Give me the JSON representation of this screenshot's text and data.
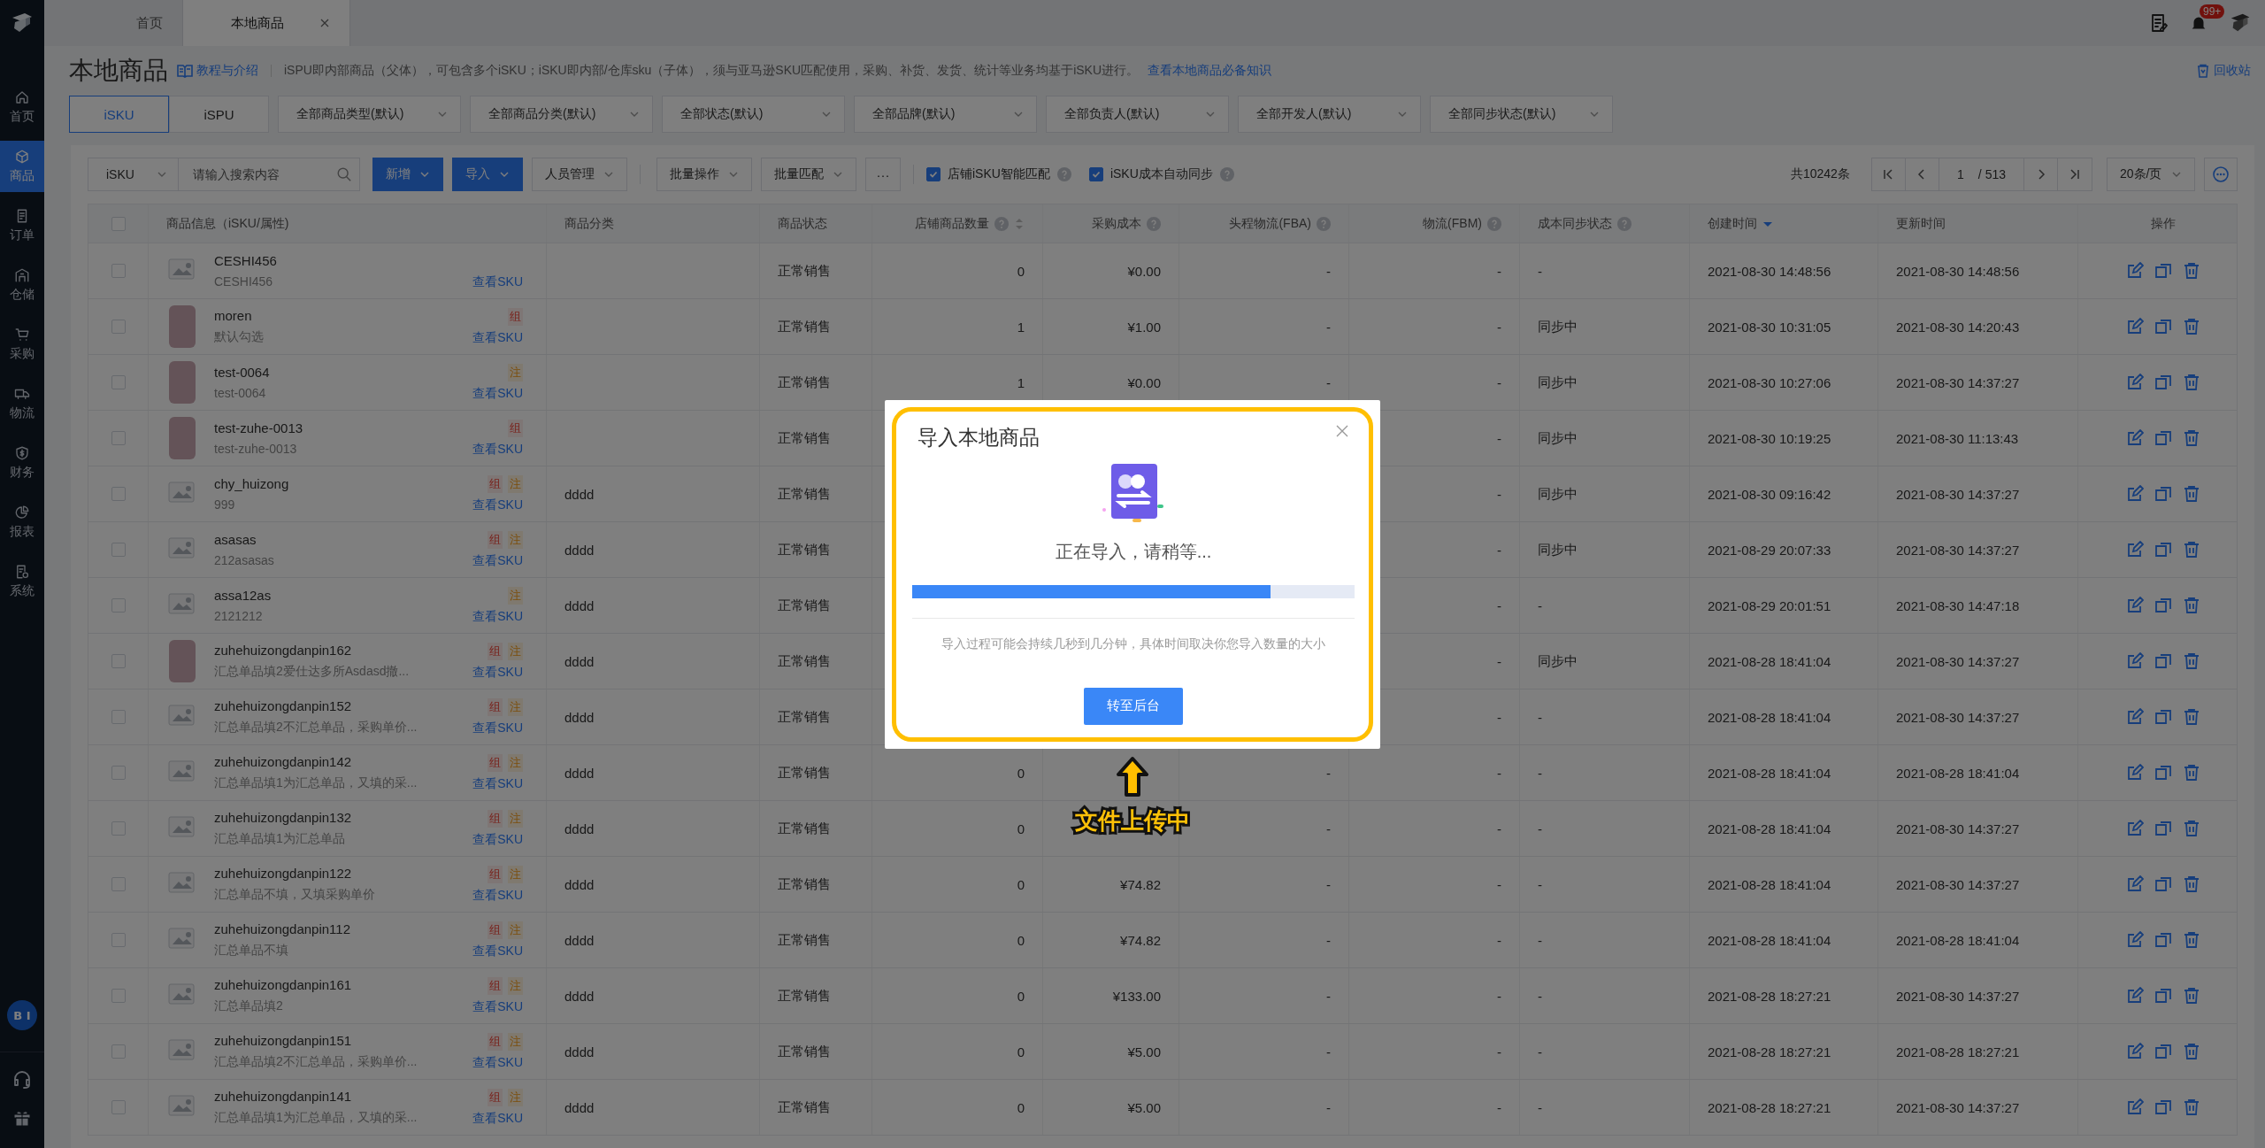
{
  "sidebar": {
    "items": [
      {
        "label": "首页",
        "selected": false
      },
      {
        "label": "商品",
        "selected": true
      },
      {
        "label": "订单",
        "selected": false
      },
      {
        "label": "仓储",
        "selected": false
      },
      {
        "label": "采购",
        "selected": false
      },
      {
        "label": "物流",
        "selected": false
      },
      {
        "label": "财务",
        "selected": false
      },
      {
        "label": "报表",
        "selected": false
      },
      {
        "label": "系统",
        "selected": false
      }
    ],
    "bi_label": "B I"
  },
  "tabs": [
    {
      "label": "首页",
      "selected": false,
      "closable": false
    },
    {
      "label": "本地商品",
      "selected": true,
      "closable": true
    }
  ],
  "notification_badge": "99+",
  "page": {
    "title": "本地商品",
    "tutorial_link": "教程与介绍",
    "description": "iSPU即内部商品（父体），可包含多个iSKU；iSKU即内部/仓库sku（子体），须与亚马逊SKU匹配使用，采购、补货、发货、统计等业务均基于iSKU进行。",
    "knowledge_link": "查看本地商品必备知识",
    "recycle_bin": "回收站"
  },
  "view_tabs": [
    {
      "label": "iSKU",
      "selected": true
    },
    {
      "label": "iSPU",
      "selected": false
    }
  ],
  "filters": [
    "全部商品类型(默认)",
    "全部商品分类(默认)",
    "全部状态(默认)",
    "全部品牌(默认)",
    "全部负责人(默认)",
    "全部开发人(默认)",
    "全部同步状态(默认)"
  ],
  "toolbar": {
    "search_type": "iSKU",
    "search_placeholder": "请输入搜索内容",
    "button_groups": [
      [
        {
          "label": "新增",
          "kind": "primary"
        },
        {
          "label": "导入",
          "kind": "primary"
        },
        {
          "label": "人员管理",
          "kind": "plain"
        }
      ],
      [
        {
          "label": "批量操作",
          "kind": "plain"
        },
        {
          "label": "批量匹配",
          "kind": "plain"
        }
      ]
    ],
    "more": "···",
    "options": [
      {
        "label": "店铺iSKU智能匹配",
        "checked": true
      },
      {
        "label": "iSKU成本自动同步",
        "checked": true
      }
    ]
  },
  "pagination": {
    "total": "共10242条",
    "page": "1",
    "pages": "/ 513",
    "page_size": "20条/页"
  },
  "table": {
    "select_all": false,
    "columns": [
      {
        "label": "商品信息（iSKU/属性)",
        "help": false,
        "sortable": false
      },
      {
        "label": "商品分类",
        "help": false,
        "sortable": false
      },
      {
        "label": "商品状态",
        "help": false,
        "sortable": false
      },
      {
        "label": "店铺商品数量",
        "help": true,
        "sortable": true,
        "sorted": false
      },
      {
        "label": "采购成本",
        "help": true,
        "sortable": false
      },
      {
        "label": "头程物流(FBA)",
        "help": true,
        "sortable": false
      },
      {
        "label": "物流(FBM)",
        "help": true,
        "sortable": false
      },
      {
        "label": "成本同步状态",
        "help": true,
        "sortable": false
      },
      {
        "label": "创建时间",
        "help": false,
        "sortable": true,
        "sorted": true
      },
      {
        "label": "更新时间",
        "help": false,
        "sortable": false
      },
      {
        "label": "操作",
        "help": false,
        "sortable": false
      }
    ],
    "rows": [
      {
        "checked": false,
        "thumbnail": {
          "kind": "placeholder"
        },
        "name": "CESHI456",
        "attribute": "CESHI456",
        "link": "查看SKU",
        "status": "正常销售",
        "store_qty": "0",
        "cost": "¥0.00",
        "fba": "-",
        "fbm": "-",
        "sync": "-",
        "created": "2021-08-30 14:48:56",
        "updated": "2021-08-30 14:48:56"
      },
      {
        "checked": false,
        "thumbnail": {
          "kind": "photo"
        },
        "name": "moren",
        "attribute": "默认勾选",
        "tags": [
          {
            "label": "组",
            "kind": "combo"
          }
        ],
        "link": "查看SKU",
        "status": "正常销售",
        "store_qty": "1",
        "cost": "¥1.00",
        "fba": "-",
        "fbm": "-",
        "sync": "同步中",
        "created": "2021-08-30 10:31:05",
        "updated": "2021-08-30 14:20:43"
      },
      {
        "checked": false,
        "thumbnail": {
          "kind": "photo"
        },
        "name": "test-0064",
        "attribute": "test-0064",
        "tags": [
          {
            "label": "注",
            "kind": "note"
          }
        ],
        "link": "查看SKU",
        "status": "正常销售",
        "store_qty": "1",
        "cost": "¥0.00",
        "fba": "-",
        "fbm": "-",
        "sync": "同步中",
        "created": "2021-08-30 10:27:06",
        "updated": "2021-08-30 14:37:27"
      },
      {
        "checked": false,
        "thumbnail": {
          "kind": "photo"
        },
        "name": "test-zuhe-0013",
        "attribute": "test-zuhe-0013",
        "tags": [
          {
            "label": "组",
            "kind": "combo"
          }
        ],
        "link": "查看SKU",
        "status": "正常销售",
        "fbm": "-",
        "sync": "同步中",
        "created": "2021-08-30 10:19:25",
        "updated": "2021-08-30 11:13:43"
      },
      {
        "checked": false,
        "thumbnail": {
          "kind": "placeholder"
        },
        "name": "chy_huizong",
        "attribute": "999",
        "tags": [
          {
            "label": "组",
            "kind": "combo"
          },
          {
            "label": "注",
            "kind": "note"
          }
        ],
        "link": "查看SKU",
        "category": "dddd",
        "status": "正常销售",
        "fbm": "-",
        "sync": "同步中",
        "created": "2021-08-30 09:16:42",
        "updated": "2021-08-30 14:37:27"
      },
      {
        "checked": false,
        "thumbnail": {
          "kind": "placeholder"
        },
        "name": "asasas",
        "attribute": "212asasas",
        "tags": [
          {
            "label": "组",
            "kind": "combo"
          },
          {
            "label": "注",
            "kind": "note"
          }
        ],
        "link": "查看SKU",
        "category": "dddd",
        "status": "正常销售",
        "fbm": "-",
        "sync": "同步中",
        "created": "2021-08-29 20:07:33",
        "updated": "2021-08-30 14:37:27"
      },
      {
        "checked": false,
        "thumbnail": {
          "kind": "placeholder"
        },
        "name": "assa12as",
        "attribute": "2121212",
        "tags": [
          {
            "label": "注",
            "kind": "note"
          }
        ],
        "link": "查看SKU",
        "category": "dddd",
        "status": "正常销售",
        "fbm": "-",
        "sync": "-",
        "created": "2021-08-29 20:01:51",
        "updated": "2021-08-30 14:47:18"
      },
      {
        "checked": false,
        "thumbnail": {
          "kind": "photo"
        },
        "name": "zuhehuizongdanpin162",
        "attribute": "汇总单品填2爱仕达多所Asdasd撤...",
        "tags": [
          {
            "label": "组",
            "kind": "combo"
          },
          {
            "label": "注",
            "kind": "note"
          }
        ],
        "link": "查看SKU",
        "category": "dddd",
        "status": "正常销售",
        "fbm": "-",
        "sync": "同步中",
        "created": "2021-08-28 18:41:04",
        "updated": "2021-08-30 14:37:27"
      },
      {
        "checked": false,
        "thumbnail": {
          "kind": "placeholder"
        },
        "name": "zuhehuizongdanpin152",
        "attribute": "汇总单品填2不汇总单品，采购单价...",
        "tags": [
          {
            "label": "组",
            "kind": "combo"
          },
          {
            "label": "注",
            "kind": "note"
          }
        ],
        "link": "查看SKU",
        "category": "dddd",
        "status": "正常销售",
        "fbm": "-",
        "sync": "-",
        "created": "2021-08-28 18:41:04",
        "updated": "2021-08-30 14:37:27"
      },
      {
        "checked": false,
        "thumbnail": {
          "kind": "placeholder"
        },
        "name": "zuhehuizongdanpin142",
        "attribute": "汇总单品填1为汇总单品，又填的采...",
        "tags": [
          {
            "label": "组",
            "kind": "combo"
          },
          {
            "label": "注",
            "kind": "note"
          }
        ],
        "link": "查看SKU",
        "category": "dddd",
        "status": "正常销售",
        "store_qty": "0",
        "fba": "-",
        "fbm": "-",
        "sync": "-",
        "created": "2021-08-28 18:41:04",
        "updated": "2021-08-28 18:41:04"
      },
      {
        "checked": false,
        "thumbnail": {
          "kind": "placeholder"
        },
        "name": "zuhehuizongdanpin132",
        "attribute": "汇总单品填1为汇总单品",
        "tags": [
          {
            "label": "组",
            "kind": "combo"
          },
          {
            "label": "注",
            "kind": "note"
          }
        ],
        "link": "查看SKU",
        "category": "dddd",
        "status": "正常销售",
        "store_qty": "0",
        "fba": "-",
        "fbm": "-",
        "sync": "-",
        "created": "2021-08-28 18:41:04",
        "updated": "2021-08-30 14:37:27"
      },
      {
        "checked": false,
        "thumbnail": {
          "kind": "placeholder"
        },
        "name": "zuhehuizongdanpin122",
        "attribute": "汇总单品不填，又填采购单价",
        "tags": [
          {
            "label": "组",
            "kind": "combo"
          },
          {
            "label": "注",
            "kind": "note"
          }
        ],
        "link": "查看SKU",
        "category": "dddd",
        "status": "正常销售",
        "store_qty": "0",
        "cost": "¥74.82",
        "fba": "-",
        "fbm": "-",
        "sync": "-",
        "created": "2021-08-28 18:41:04",
        "updated": "2021-08-30 14:37:27"
      },
      {
        "checked": false,
        "thumbnail": {
          "kind": "placeholder"
        },
        "name": "zuhehuizongdanpin112",
        "attribute": "汇总单品不填",
        "tags": [
          {
            "label": "组",
            "kind": "combo"
          },
          {
            "label": "注",
            "kind": "note"
          }
        ],
        "link": "查看SKU",
        "category": "dddd",
        "status": "正常销售",
        "store_qty": "0",
        "cost": "¥74.82",
        "fba": "-",
        "fbm": "-",
        "sync": "-",
        "created": "2021-08-28 18:41:04",
        "updated": "2021-08-28 18:41:04"
      },
      {
        "checked": false,
        "thumbnail": {
          "kind": "placeholder"
        },
        "name": "zuhehuizongdanpin161",
        "attribute": "汇总单品填2",
        "tags": [
          {
            "label": "组",
            "kind": "combo"
          },
          {
            "label": "注",
            "kind": "note"
          }
        ],
        "link": "查看SKU",
        "category": "dddd",
        "status": "正常销售",
        "store_qty": "0",
        "cost": "¥133.00",
        "fba": "-",
        "fbm": "-",
        "sync": "-",
        "created": "2021-08-28 18:27:21",
        "updated": "2021-08-30 14:37:27"
      },
      {
        "checked": false,
        "thumbnail": {
          "kind": "placeholder"
        },
        "name": "zuhehuizongdanpin151",
        "attribute": "汇总单品填2不汇总单品，采购单价...",
        "tags": [
          {
            "label": "组",
            "kind": "combo"
          },
          {
            "label": "注",
            "kind": "note"
          }
        ],
        "link": "查看SKU",
        "category": "dddd",
        "status": "正常销售",
        "store_qty": "0",
        "cost": "¥5.00",
        "fba": "-",
        "fbm": "-",
        "sync": "-",
        "created": "2021-08-28 18:27:21",
        "updated": "2021-08-28 18:27:21"
      },
      {
        "checked": false,
        "thumbnail": {
          "kind": "placeholder"
        },
        "name": "zuhehuizongdanpin141",
        "attribute": "汇总单品填1为汇总单品，又填的采...",
        "tags": [
          {
            "label": "组",
            "kind": "combo"
          },
          {
            "label": "注",
            "kind": "note"
          }
        ],
        "link": "查看SKU",
        "category": "dddd",
        "status": "正常销售",
        "store_qty": "0",
        "cost": "¥5.00",
        "fba": "-",
        "fbm": "-",
        "sync": "-",
        "created": "2021-08-28 18:27:21",
        "updated": "2021-08-30 14:37:27"
      }
    ]
  },
  "modal": {
    "title": "导入本地商品",
    "status": "正在导入，请稍等...",
    "progress": {
      "level": 0.81
    },
    "hint": "导入过程可能会持续几秒到几分钟，具体时间取决你您导入数量的大小",
    "button": "转至后台"
  },
  "annotation": {
    "label": "文件上传中"
  }
}
